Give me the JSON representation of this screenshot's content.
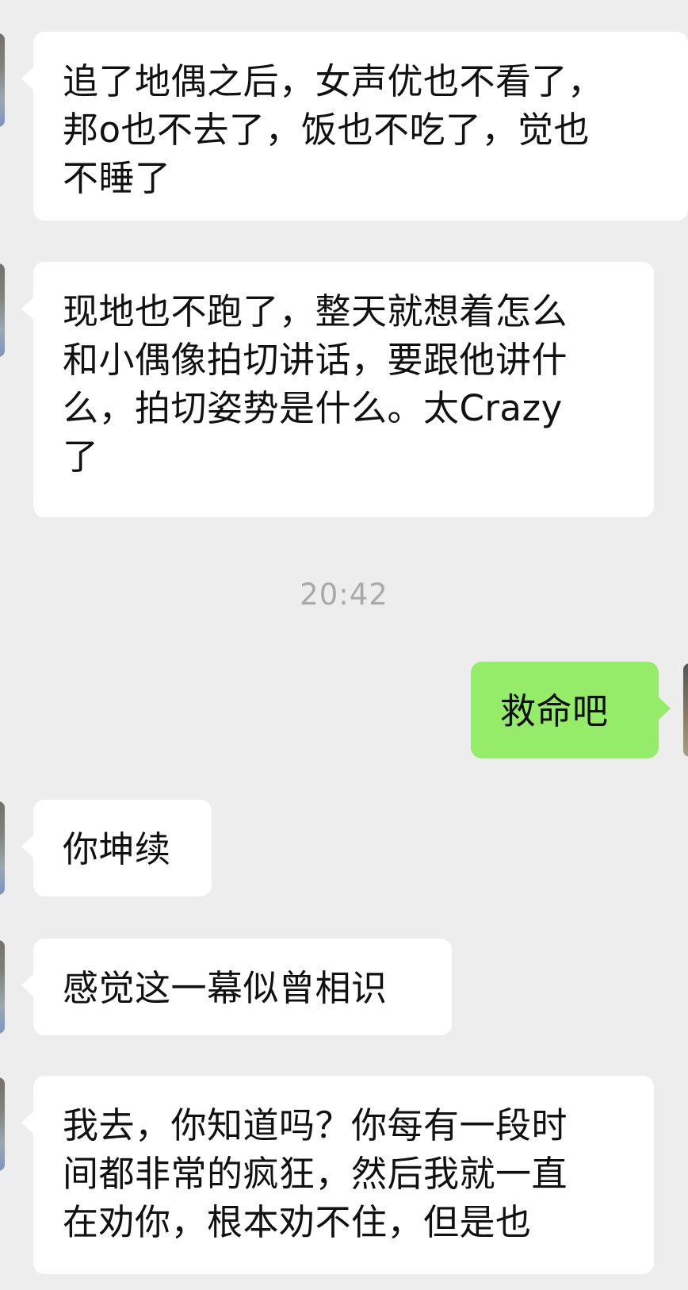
{
  "chat": {
    "messages": [
      {
        "sender": "other",
        "lines": [
          "追了地偶之后，女声优也不看了，",
          "邦o也不去了，饭也不吃了，觉也",
          "不睡了"
        ]
      },
      {
        "sender": "other",
        "lines": [
          "现地也不跑了，整天就想着怎么",
          "和小偶像拍切讲话，要跟他讲什",
          "么，拍切姿势是什么。太Crazy",
          "了"
        ]
      },
      {
        "sender": "self",
        "lines": [
          "救命吧"
        ]
      },
      {
        "sender": "other",
        "lines": [
          "你坤续"
        ]
      },
      {
        "sender": "other",
        "lines": [
          "感觉这一幕似曾相识"
        ]
      },
      {
        "sender": "other",
        "lines": [
          "我去，你知道吗？你每有一段时",
          "间都非常的疯狂，然后我就一直",
          "在劝你，根本劝不住，但是也"
        ]
      }
    ],
    "timestamp": "20:42"
  },
  "colors": {
    "background": "#ededed",
    "incoming_bubble": "#ffffff",
    "outgoing_bubble": "#95ec69",
    "timestamp_text": "#a9a9a9",
    "message_text": "#111111"
  }
}
